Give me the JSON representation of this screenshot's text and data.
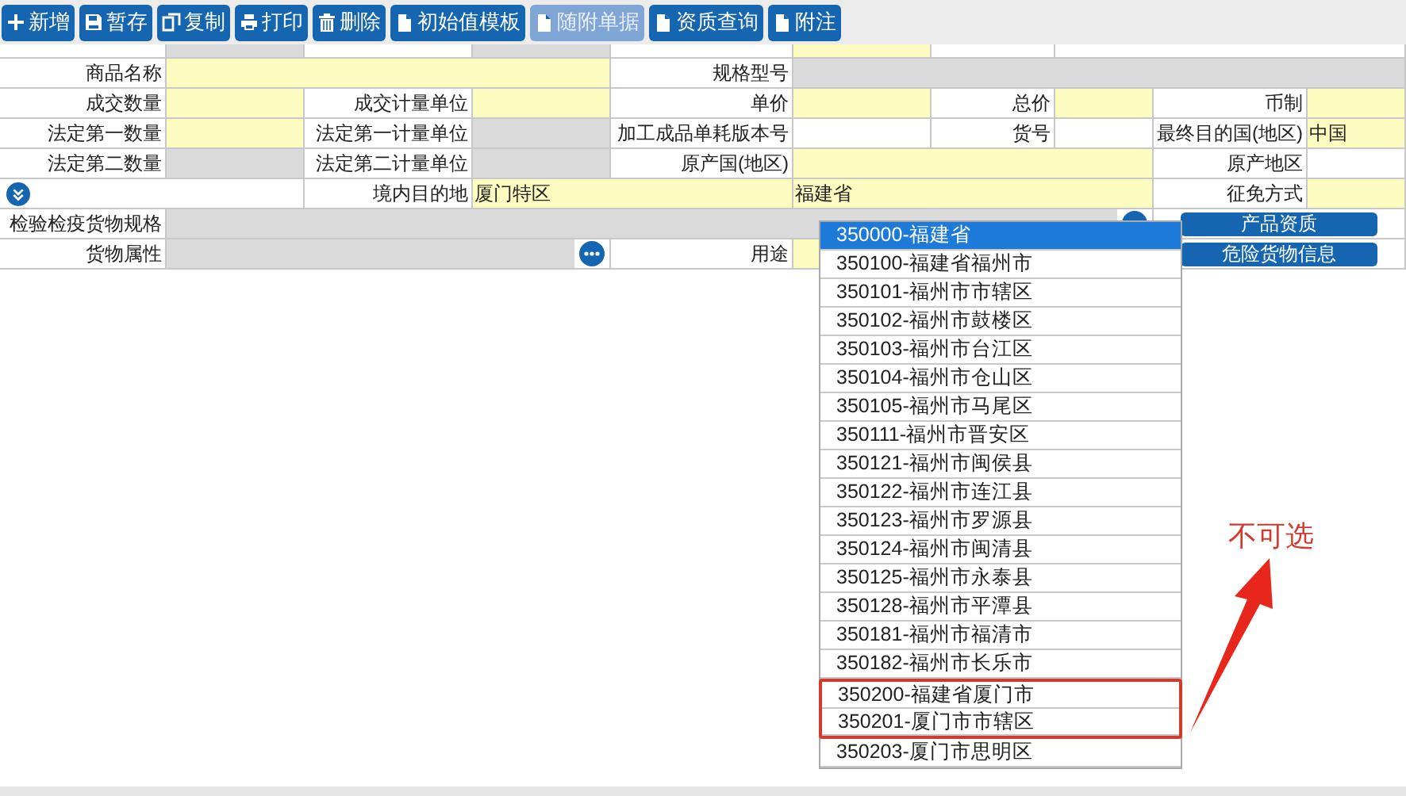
{
  "toolbar": [
    {
      "kind": "plus",
      "label": "新增",
      "disabled": false
    },
    {
      "kind": "save",
      "label": "暂存",
      "disabled": false
    },
    {
      "kind": "copy",
      "label": "复制",
      "disabled": false
    },
    {
      "kind": "print",
      "label": "打印",
      "disabled": false
    },
    {
      "kind": "trash",
      "label": "删除",
      "disabled": false
    },
    {
      "kind": "doc",
      "label": "初始值模板",
      "disabled": false
    },
    {
      "kind": "doc",
      "label": "随附单据",
      "disabled": true
    },
    {
      "kind": "doc",
      "label": "资质查询",
      "disabled": false
    },
    {
      "kind": "doc",
      "label": "附注",
      "disabled": false
    }
  ],
  "form_rows": [
    {
      "cells": [
        {
          "kind": "label"
        },
        {
          "kind": "input",
          "readonly": true
        },
        {
          "kind": "label"
        },
        {
          "kind": "input",
          "readonly": true
        },
        {
          "kind": "label"
        },
        {
          "kind": "input",
          "required": true,
          "readonly": false
        },
        {
          "kind": "label"
        },
        {
          "kind": "input",
          "required": false,
          "readonly": false
        }
      ]
    },
    {
      "cells": [
        {
          "kind": "label",
          "text": "商品名称"
        },
        {
          "kind": "input",
          "required": true,
          "readonly": false
        },
        {
          "kind": "label",
          "text": "规格型号"
        },
        {
          "kind": "input",
          "readonly": true
        }
      ]
    },
    {
      "cells": [
        {
          "kind": "label",
          "text": "成交数量"
        },
        {
          "kind": "input",
          "required": true,
          "readonly": false
        },
        {
          "kind": "label",
          "text": "成交计量单位"
        },
        {
          "kind": "input",
          "required": true,
          "readonly": false
        },
        {
          "kind": "label",
          "text": "单价"
        },
        {
          "kind": "input",
          "required": true,
          "readonly": false
        },
        {
          "kind": "label",
          "text": "总价"
        },
        {
          "kind": "input",
          "required": true,
          "readonly": false
        },
        {
          "kind": "label",
          "text": "币制"
        },
        {
          "kind": "input",
          "required": true,
          "readonly": false
        }
      ]
    },
    {
      "cells": [
        {
          "kind": "label",
          "text": "法定第一数量"
        },
        {
          "kind": "input",
          "required": true,
          "readonly": false
        },
        {
          "kind": "label",
          "text": "法定第一计量单位"
        },
        {
          "kind": "input",
          "readonly": true
        },
        {
          "kind": "label",
          "text": "加工成品单耗版本号"
        },
        {
          "kind": "input",
          "required": false,
          "readonly": false
        },
        {
          "kind": "label",
          "text": "货号"
        },
        {
          "kind": "input",
          "required": false,
          "readonly": false
        },
        {
          "kind": "label",
          "text": "最终目的国(地区)"
        },
        {
          "kind": "input",
          "required": true,
          "readonly": false,
          "value": "中国"
        }
      ]
    },
    {
      "cells": [
        {
          "kind": "label",
          "text": "法定第二数量"
        },
        {
          "kind": "input",
          "readonly": true
        },
        {
          "kind": "label",
          "text": "法定第二计量单位"
        },
        {
          "kind": "input",
          "readonly": true
        },
        {
          "kind": "label",
          "text": "原产国(地区)"
        },
        {
          "kind": "input",
          "required": true,
          "readonly": false
        },
        {
          "kind": "label",
          "text": "原产地区"
        },
        {
          "kind": "input",
          "required": false,
          "readonly": false
        }
      ]
    },
    {
      "cells": [
        {
          "kind": "expand"
        },
        {
          "kind": "label",
          "text": "境内目的地"
        },
        {
          "kind": "input",
          "required": true,
          "readonly": false,
          "value": "厦门特区"
        },
        {
          "kind": "input",
          "required": true,
          "readonly": false,
          "value": "福建省"
        },
        {
          "kind": "label",
          "text": "征免方式"
        },
        {
          "kind": "input",
          "required": true,
          "readonly": false
        }
      ]
    },
    {
      "cells": [
        {
          "kind": "label",
          "text": "检验检疫货物规格"
        },
        {
          "kind": "lookup",
          "readonly": true
        },
        {
          "kind": "button",
          "text": "产品资质"
        }
      ]
    },
    {
      "cells": [
        {
          "kind": "label",
          "text": "货物属性"
        },
        {
          "kind": "lookup",
          "readonly": true
        },
        {
          "kind": "label",
          "text": "用途"
        },
        {
          "kind": "input",
          "required": true,
          "readonly": false
        },
        {
          "kind": "button",
          "text": "危险货物信息"
        }
      ]
    }
  ],
  "dropdown": {
    "items": [
      {
        "text": "350000-福建省",
        "selected": true,
        "flagged": false
      },
      {
        "text": "350100-福建省福州市",
        "selected": false,
        "flagged": false
      },
      {
        "text": "350101-福州市市辖区",
        "selected": false,
        "flagged": false
      },
      {
        "text": "350102-福州市鼓楼区",
        "selected": false,
        "flagged": false
      },
      {
        "text": "350103-福州市台江区",
        "selected": false,
        "flagged": false
      },
      {
        "text": "350104-福州市仓山区",
        "selected": false,
        "flagged": false
      },
      {
        "text": "350105-福州市马尾区",
        "selected": false,
        "flagged": false
      },
      {
        "text": "350111-福州市晋安区",
        "selected": false,
        "flagged": false
      },
      {
        "text": "350121-福州市闽侯县",
        "selected": false,
        "flagged": false
      },
      {
        "text": "350122-福州市连江县",
        "selected": false,
        "flagged": false
      },
      {
        "text": "350123-福州市罗源县",
        "selected": false,
        "flagged": false
      },
      {
        "text": "350124-福州市闽清县",
        "selected": false,
        "flagged": false
      },
      {
        "text": "350125-福州市永泰县",
        "selected": false,
        "flagged": false
      },
      {
        "text": "350128-福州市平潭县",
        "selected": false,
        "flagged": false
      },
      {
        "text": "350181-福州市福清市",
        "selected": false,
        "flagged": false
      },
      {
        "text": "350182-福州市长乐市",
        "selected": false,
        "flagged": false
      },
      {
        "text": "350200-福建省厦门市",
        "selected": false,
        "flagged": true
      },
      {
        "text": "350201-厦门市市辖区",
        "selected": false,
        "flagged": true
      },
      {
        "text": "350203-厦门市思明区",
        "selected": false,
        "flagged": false
      }
    ]
  },
  "annotation": {
    "text": "不可选"
  }
}
